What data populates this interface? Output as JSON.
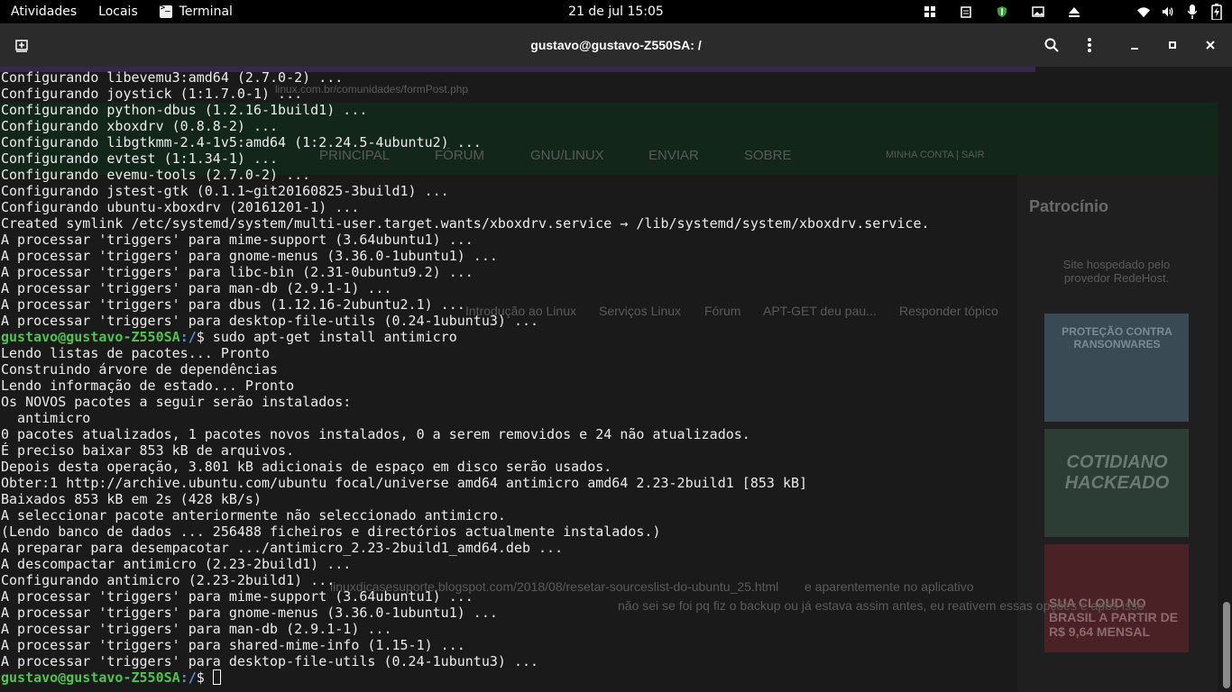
{
  "topbar": {
    "activities": "Atividades",
    "places": "Locais",
    "app_name": "Terminal",
    "app_icon": "terminal-icon",
    "clock": "21 de jul  15:05",
    "tray_icons": [
      "grid-icon",
      "clipboard-icon",
      "shield-icon",
      "image-icon",
      "eject-icon",
      "wifi-icon",
      "volume-icon",
      "microphone-icon",
      "battery-icon"
    ]
  },
  "window": {
    "title": "gustavo@gustavo-Z550SA: /",
    "buttons": [
      "new-tab-icon",
      "search-icon",
      "menu-icon",
      "minimize-icon",
      "maximize-icon",
      "close-icon"
    ]
  },
  "terminal": {
    "lines": [
      {
        "text": "Configurando libevemu3:amd64 (2.7.0-2) ..."
      },
      {
        "text": "Configurando joystick (1:1.7.0-1) ..."
      },
      {
        "text": "Configurando python-dbus (1.2.16-1build1) ..."
      },
      {
        "text": "Configurando xboxdrv (0.8.8-2) ..."
      },
      {
        "text": "Configurando libgtkmm-2.4-1v5:amd64 (1:2.24.5-4ubuntu2) ..."
      },
      {
        "text": "Configurando evtest (1:1.34-1) ..."
      },
      {
        "text": "Configurando evemu-tools (2.7.0-2) ..."
      },
      {
        "text": "Configurando jstest-gtk (0.1.1~git20160825-3build1) ..."
      },
      {
        "text": "Configurando ubuntu-xboxdrv (20161201-1) ..."
      },
      {
        "text": "Created symlink /etc/systemd/system/multi-user.target.wants/xboxdrv.service → /lib/systemd/system/xboxdrv.service."
      },
      {
        "text": "A processar 'triggers' para mime-support (3.64ubuntu1) ..."
      },
      {
        "text": "A processar 'triggers' para gnome-menus (3.36.0-1ubuntu1) ..."
      },
      {
        "text": "A processar 'triggers' para libc-bin (2.31-0ubuntu9.2) ..."
      },
      {
        "text": "A processar 'triggers' para man-db (2.9.1-1) ..."
      },
      {
        "text": "A processar 'triggers' para dbus (1.12.16-2ubuntu2.1) ..."
      },
      {
        "text": "A processar 'triggers' para desktop-file-utils (0.24-1ubuntu3) ..."
      },
      {
        "prompt_user": "gustavo@gustavo-Z550SA",
        "prompt_path": ":/",
        "text": "$ sudo apt-get install antimicro"
      },
      {
        "text": "Lendo listas de pacotes... Pronto"
      },
      {
        "text": "Construindo árvore de dependências"
      },
      {
        "text": "Lendo informação de estado... Pronto"
      },
      {
        "text": "Os NOVOS pacotes a seguir serão instalados:"
      },
      {
        "text": "  antimicro"
      },
      {
        "text": "0 pacotes atualizados, 1 pacotes novos instalados, 0 a serem removidos e 24 não atualizados."
      },
      {
        "text": "É preciso baixar 853 kB de arquivos."
      },
      {
        "text": "Depois desta operação, 3.801 kB adicionais de espaço em disco serão usados."
      },
      {
        "text": "Obter:1 http://archive.ubuntu.com/ubuntu focal/universe amd64 antimicro amd64 2.23-2build1 [853 kB]"
      },
      {
        "text": "Baixados 853 kB em 2s (428 kB/s)"
      },
      {
        "text": "A seleccionar pacote anteriormente não seleccionado antimicro."
      },
      {
        "text": "(Lendo banco de dados ... 256488 ficheiros e directórios actualmente instalados.)"
      },
      {
        "text": "A preparar para desempacotar .../antimicro_2.23-2build1_amd64.deb ..."
      },
      {
        "text": "A descompactar antimicro (2.23-2build1) ..."
      },
      {
        "text": "Configurando antimicro (2.23-2build1) ..."
      },
      {
        "text": "A processar 'triggers' para mime-support (3.64ubuntu1) ..."
      },
      {
        "text": "A processar 'triggers' para gnome-menus (3.36.0-1ubuntu1) ..."
      },
      {
        "text": "A processar 'triggers' para man-db (2.9.1-1) ..."
      },
      {
        "text": "A processar 'triggers' para shared-mime-info (1.15-1) ..."
      },
      {
        "text": "A processar 'triggers' para desktop-file-utils (0.24-1ubuntu3) ..."
      },
      {
        "prompt_user": "gustavo@gustavo-Z550SA",
        "prompt_path": ":/",
        "text": "$ ",
        "cursor": true
      }
    ]
  },
  "background_page": {
    "url": "linux.com.br/comunidades/formPost.php",
    "nav": [
      "PRINCIPAL",
      "FÓRUM",
      "GNU/LINUX",
      "ENVIAR",
      "SOBRE"
    ],
    "account": "MINHA CONTA |  SAIR",
    "sidebar_title": "Patrocínio",
    "hosted": "Site hospedado pelo provedor RedeHost.",
    "breadcrumb": [
      "Introdução ao Linux",
      "Serviços Linux",
      "Fórum",
      "APT-GET deu pau...",
      "Responder tópico"
    ],
    "ad1": "PROTEÇÃO CONTRA RANSONWARES",
    "ad2": "COTIDIANO HACKEADO",
    "ad3": "SUA CLOUD NO BRASIL A PARTIR DE R$ 9,64 MENSAL",
    "post_link": "linuxdicasesuporte.blogspot.com/2018/08/resetar-sourceslist-do-ubuntu_25.html",
    "post_text": "e aparentemente no aplicativo",
    "post_text2": "não sei se foi pq fiz o backup ou já estava assim antes, eu reativem essas opções e após isso"
  },
  "colors": {
    "prompt_user": "#4ec44e",
    "prompt_path": "#5a8fd6",
    "terminal_bg": "#1a1a1a",
    "header_bg": "#2b2b2b"
  }
}
